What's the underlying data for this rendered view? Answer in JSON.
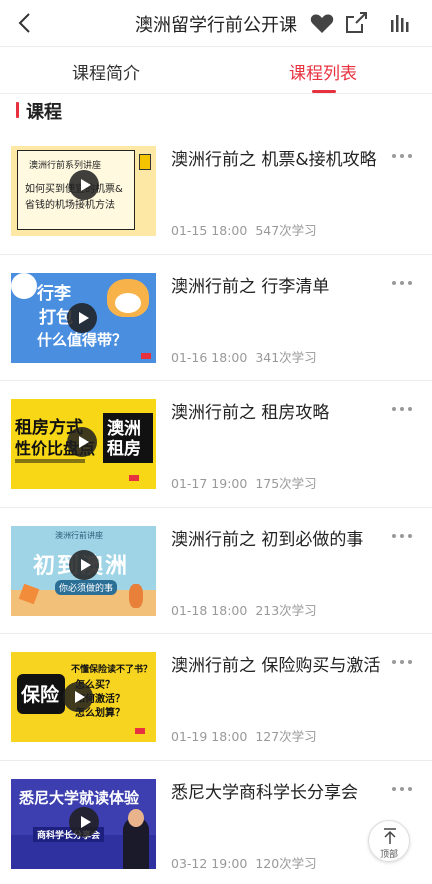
{
  "nav": {
    "title": "澳洲留学行前公开课",
    "icons": [
      "back-icon",
      "heart-icon",
      "share-icon",
      "stats-icon"
    ]
  },
  "tabs": [
    {
      "label": "课程简介",
      "active": false
    },
    {
      "label": "课程列表",
      "active": true
    }
  ],
  "section": {
    "title": "课程"
  },
  "courses": [
    {
      "title": "澳洲行前之 机票&接机攻略",
      "date": "01-15 18:00",
      "views": "547次学习",
      "thumb": {
        "bg": "#fde8a6",
        "lines": [
          "澳洲行前系列讲座",
          "如何买到便宜的机票&",
          "省钱的机场接机方法"
        ]
      }
    },
    {
      "title": "澳洲行前之 行李清单",
      "date": "01-16 18:00",
      "views": "341次学习",
      "thumb": {
        "bg": "#4a8ee0",
        "lines": [
          "行李",
          "打包",
          "什么值得带？"
        ]
      }
    },
    {
      "title": "澳洲行前之 租房攻略",
      "date": "01-17 19:00",
      "views": "175次学习",
      "thumb": {
        "bg": "#f7d716",
        "lines": [
          "租房方式",
          "性价比盘点",
          "澳洲租房"
        ]
      }
    },
    {
      "title": "澳洲行前之 初到必做的事",
      "date": "01-18 18:00",
      "views": "213次学习",
      "thumb": {
        "bg": "#9fd4e6",
        "lines": [
          "澳洲行前讲座",
          "初到澳洲",
          "你必须做的事"
        ]
      }
    },
    {
      "title": "澳洲行前之 保险购买与激活",
      "date": "01-19 18:00",
      "views": "127次学习",
      "thumb": {
        "bg": "#f7d420",
        "lines": [
          "保险",
          "不懂保险读不了书？",
          "怎么买？",
          "如何激活？",
          "怎么划算？"
        ]
      }
    },
    {
      "title": "悉尼大学商科学长分享会",
      "date": "03-12 19:00",
      "views": "120次学习",
      "thumb": {
        "bg": "#3d3fb0",
        "lines": [
          "悉尼大学就读体验",
          "商科学长分享会"
        ]
      }
    }
  ],
  "back_to_top": {
    "label": "顶部"
  },
  "colors": {
    "accent": "#e8313f",
    "meta": "#999999",
    "divider": "#ececec"
  }
}
